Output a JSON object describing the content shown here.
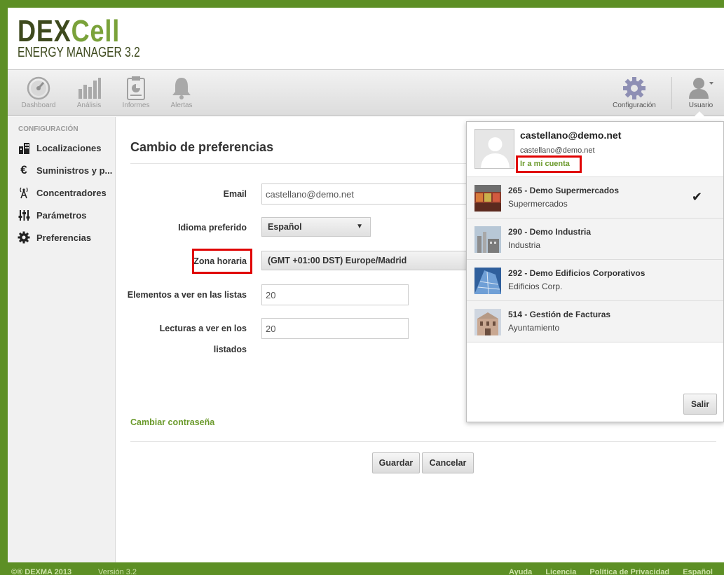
{
  "logo": {
    "brand_a": "DEX",
    "brand_b": "Cell",
    "subtitle": "ENERGY MANAGER 3.2"
  },
  "toolbar": {
    "items": [
      {
        "label": "Dashboard",
        "icon": "dashboard-icon"
      },
      {
        "label": "Análisis",
        "icon": "analysis-icon"
      },
      {
        "label": "Informes",
        "icon": "reports-icon"
      },
      {
        "label": "Alertas",
        "icon": "bell-icon"
      }
    ],
    "config_label": "Configuración",
    "user_label": "Usuario"
  },
  "sidebar": {
    "title": "CONFIGURACIÓN",
    "items": [
      {
        "label": "Localizaciones",
        "icon": "building-icon"
      },
      {
        "label": "Suministros y p...",
        "icon": "euro-icon"
      },
      {
        "label": "Concentradores",
        "icon": "antenna-icon"
      },
      {
        "label": "Parámetros",
        "icon": "sliders-icon"
      },
      {
        "label": "Preferencias",
        "icon": "gear-icon"
      }
    ]
  },
  "form": {
    "title": "Cambio de preferencias",
    "email_label": "Email",
    "email_value": "castellano@demo.net",
    "language_label": "Idioma preferido",
    "language_value": "Español",
    "timezone_label": "Zona horaria",
    "timezone_value": "(GMT +01:00 DST) Europe/Madrid",
    "list_items_label": "Elementos a ver en las listas",
    "list_items_value": "20",
    "readings_label_1": "Lecturas a ver en los",
    "readings_label_2": "listados",
    "readings_value": "20",
    "change_password": "Cambiar contraseña",
    "save_label": "Guardar",
    "cancel_label": "Cancelar"
  },
  "user_menu": {
    "name": "castellano@demo.net",
    "email": "castellano@demo.net",
    "account_link": "Ir a mi cuenta",
    "accounts": [
      {
        "title": "265 - Demo Supermercados",
        "subtitle": "Supermercados",
        "selected": true
      },
      {
        "title": "290 - Demo Industria",
        "subtitle": "Industria",
        "selected": false
      },
      {
        "title": "292 - Demo Edificios Corporativos",
        "subtitle": "Edificios Corp.",
        "selected": false
      },
      {
        "title": "514 - Gestión de Facturas",
        "subtitle": "Ayuntamiento",
        "selected": false
      }
    ],
    "logout_label": "Salir"
  },
  "footer": {
    "copyright": "©® DEXMA 2013",
    "version": "Versión 3.2",
    "links": [
      "Ayuda",
      "Licencia",
      "Política de Privacidad",
      "Español"
    ]
  },
  "colors": {
    "accent_green": "#6b9a2c",
    "highlight_red": "#e00000",
    "background_green": "#5d8f25"
  }
}
